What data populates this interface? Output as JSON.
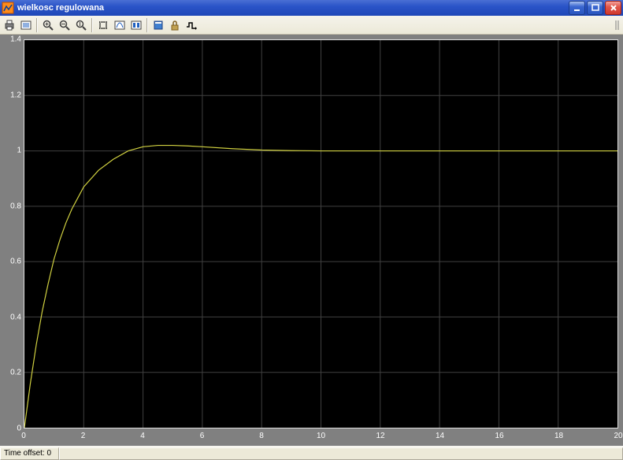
{
  "window": {
    "title": "wielkosc regulowana"
  },
  "toolbar": {
    "print": "print-icon",
    "params": "params-icon",
    "zoom_in": "zoom-in-icon",
    "zoom_out": "zoom-out-icon",
    "zoom_reset": "zoom-reset-icon",
    "autoscale": "autoscale-icon",
    "save": "save-icon",
    "restore": "restore-icon",
    "float": "float-icon",
    "lock": "lock-icon",
    "signal": "signal-icon"
  },
  "status": {
    "label": "Time offset:",
    "value": "0"
  },
  "chart_data": {
    "type": "line",
    "xlabel": "",
    "ylabel": "",
    "xlim": [
      0,
      20
    ],
    "ylim": [
      0,
      1.4
    ],
    "xticks": [
      0,
      2,
      4,
      6,
      8,
      10,
      12,
      14,
      16,
      18,
      20
    ],
    "yticks": [
      0,
      0.2,
      0.4,
      0.6,
      0.8,
      1,
      1.2,
      1.4
    ],
    "line_color": "#d0d040",
    "series": [
      {
        "name": "wielkosc regulowana",
        "x": [
          0,
          0.2,
          0.4,
          0.6,
          0.8,
          1.0,
          1.2,
          1.4,
          1.6,
          1.8,
          2.0,
          2.5,
          3.0,
          3.5,
          4.0,
          4.5,
          5.0,
          5.5,
          6.0,
          7.0,
          8.0,
          9.0,
          10,
          12,
          14,
          16,
          18,
          20
        ],
        "y": [
          0,
          0.16,
          0.3,
          0.42,
          0.52,
          0.61,
          0.68,
          0.74,
          0.79,
          0.83,
          0.87,
          0.93,
          0.97,
          1.0,
          1.015,
          1.02,
          1.02,
          1.018,
          1.015,
          1.008,
          1.003,
          1.001,
          1.0,
          1.0,
          1.0,
          1.0,
          1.0,
          1.0
        ]
      }
    ]
  }
}
